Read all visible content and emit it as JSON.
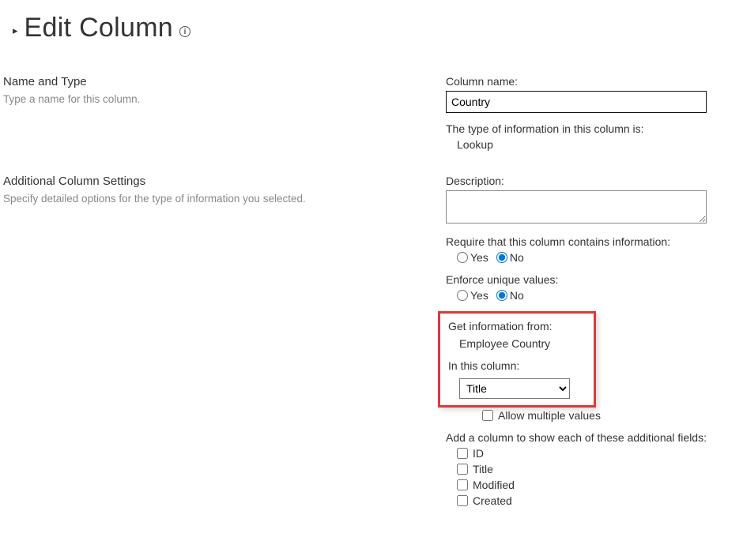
{
  "page": {
    "title": "Edit Column"
  },
  "nameType": {
    "heading": "Name and Type",
    "desc": "Type a name for this column.",
    "nameLabel": "Column name:",
    "nameValue": "Country",
    "typeLabel": "The type of information in this column is:",
    "typeValue": "Lookup"
  },
  "settings": {
    "heading": "Additional Column Settings",
    "desc": "Specify detailed options for the type of information you selected.",
    "descLabel": "Description:",
    "descValue": "",
    "requireLabel": "Require that this column contains information:",
    "yes": "Yes",
    "no": "No",
    "uniqueLabel": "Enforce unique values:",
    "sourceLabel": "Get information from:",
    "sourceValue": "Employee Country",
    "columnLabel": "In this column:",
    "columnValue": "Title",
    "allowMultiple": "Allow multiple values",
    "addFieldsLabel": "Add a column to show each of these additional fields:",
    "addFields": [
      "ID",
      "Title",
      "Modified",
      "Created"
    ]
  }
}
